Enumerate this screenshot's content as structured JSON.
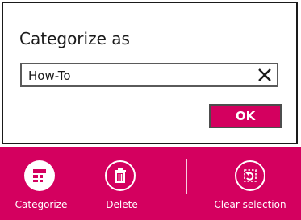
{
  "dialog": {
    "title": "Categorize as",
    "input_value": "How-To",
    "ok_label": "OK"
  },
  "appbar": {
    "background": "#d4005f",
    "buttons": [
      {
        "label": "Categorize",
        "icon": "categorize-icon"
      },
      {
        "label": "Delete",
        "icon": "trash-icon"
      },
      {
        "label": "Clear selection",
        "icon": "clear-selection-icon"
      }
    ]
  },
  "colors": {
    "accent": "#d4005f",
    "text": "#1a1a1a"
  }
}
